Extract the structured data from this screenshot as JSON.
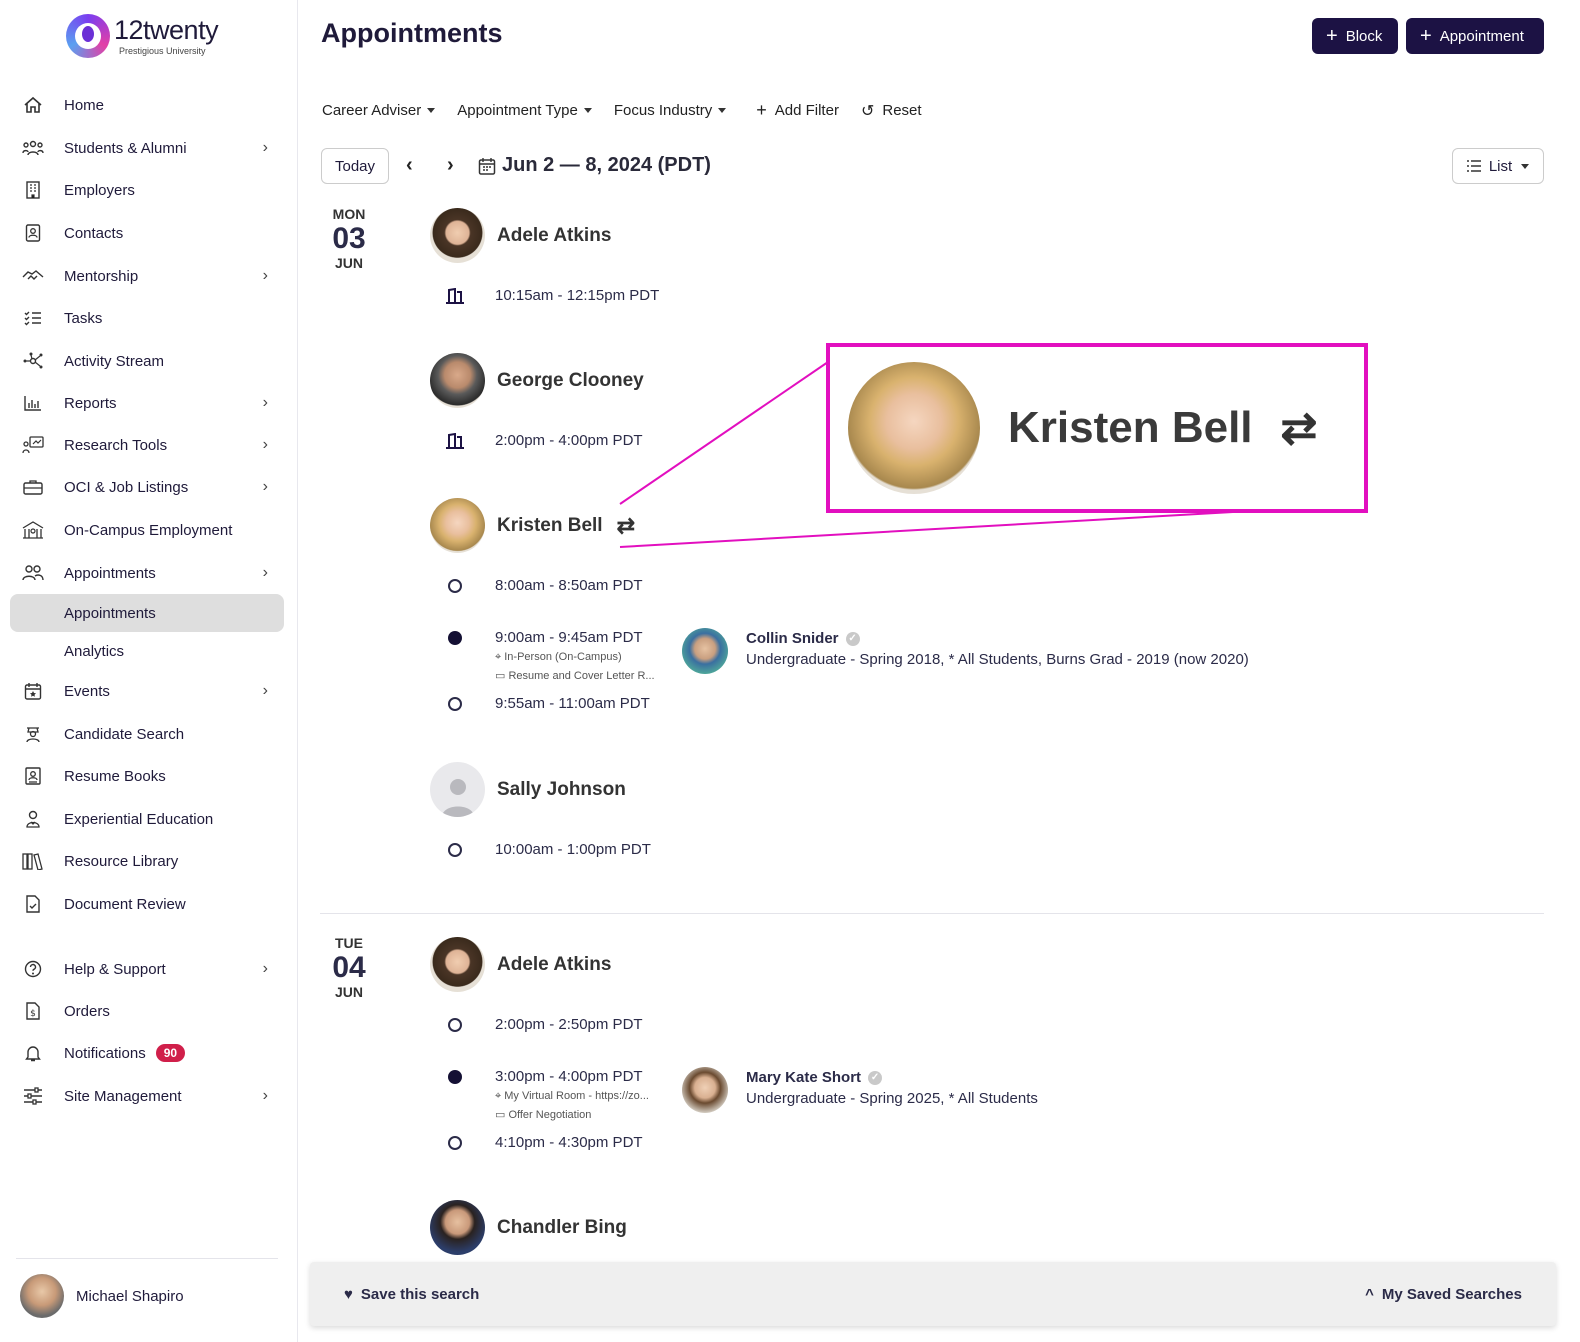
{
  "brand": {
    "name": "12twenty",
    "subtitle": "Prestigious University"
  },
  "sidebar": {
    "items": [
      {
        "label": "Home",
        "icon": "home-icon"
      },
      {
        "label": "Students & Alumni",
        "icon": "users-icon"
      },
      {
        "label": "Employers",
        "icon": "building-icon"
      },
      {
        "label": "Contacts",
        "icon": "contact-card-icon"
      },
      {
        "label": "Mentorship",
        "icon": "handshake-icon"
      },
      {
        "label": "Tasks",
        "icon": "checklist-icon"
      },
      {
        "label": "Activity Stream",
        "icon": "network-icon"
      },
      {
        "label": "Reports",
        "icon": "bar-chart-icon"
      },
      {
        "label": "Research Tools",
        "icon": "research-icon"
      },
      {
        "label": "OCI & Job Listings",
        "icon": "briefcase-icon"
      },
      {
        "label": "On-Campus Employment",
        "icon": "campus-icon"
      },
      {
        "label": "Appointments",
        "icon": "people-icon"
      },
      {
        "label": "Appointments"
      },
      {
        "label": "Analytics"
      },
      {
        "label": "Events",
        "icon": "calendar-star-icon"
      },
      {
        "label": "Candidate Search",
        "icon": "candidate-search-icon"
      },
      {
        "label": "Resume Books",
        "icon": "resume-book-icon"
      },
      {
        "label": "Experiential Education",
        "icon": "person-badge-icon"
      },
      {
        "label": "Resource Library",
        "icon": "library-icon"
      },
      {
        "label": "Document Review",
        "icon": "document-check-icon"
      },
      {
        "label": "Help & Support",
        "icon": "help-icon"
      },
      {
        "label": "Orders",
        "icon": "receipt-icon"
      },
      {
        "label": "Notifications",
        "icon": "bell-icon",
        "badge": "90"
      },
      {
        "label": "Site Management",
        "icon": "sliders-icon"
      }
    ],
    "user": {
      "name": "Michael Shapiro"
    }
  },
  "header": {
    "title": "Appointments",
    "block_label": "Block",
    "appointment_label": "Appointment"
  },
  "filters": {
    "career_adviser": "Career Adviser",
    "appointment_type": "Appointment Type",
    "focus_industry": "Focus Industry",
    "add_filter": "Add Filter",
    "reset": "Reset"
  },
  "toolbar": {
    "today": "Today",
    "date_range": "Jun 2 — 8, 2024 (PDT)",
    "view": "List"
  },
  "days": [
    {
      "dow": "MON",
      "day": "03",
      "month": "JUN",
      "advisers": [
        {
          "name": "Adele Atkins",
          "slots": [
            {
              "time": "10:15am - 12:15pm PDT"
            }
          ]
        },
        {
          "name": "George Clooney",
          "slots": [
            {
              "time": "2:00pm - 4:00pm PDT"
            }
          ]
        },
        {
          "name": "Kristen Bell",
          "slots": [
            {
              "time": "8:00am - 8:50am PDT"
            },
            {
              "time": "9:00am - 9:45am PDT",
              "location": "In-Person (On-Campus)",
              "topic": "Resume and Cover Letter R...",
              "student": {
                "name": "Collin Snider",
                "desc": "Undergraduate - Spring 2018, * All Students, Burns Grad - 2019 (now 2020)"
              }
            },
            {
              "time": "9:55am - 11:00am PDT"
            }
          ]
        },
        {
          "name": "Sally Johnson",
          "slots": [
            {
              "time": "10:00am - 1:00pm PDT"
            }
          ]
        }
      ]
    },
    {
      "dow": "TUE",
      "day": "04",
      "month": "JUN",
      "advisers": [
        {
          "name": "Adele Atkins",
          "slots": [
            {
              "time": "2:00pm - 2:50pm PDT"
            },
            {
              "time": "3:00pm - 4:00pm PDT",
              "location": "My Virtual Room - https://zo...",
              "topic": "Offer Negotiation",
              "student": {
                "name": "Mary Kate Short",
                "desc": "Undergraduate - Spring 2025, * All Students"
              }
            },
            {
              "time": "4:10pm - 4:30pm PDT"
            }
          ]
        },
        {
          "name": "Chandler Bing"
        }
      ]
    }
  ],
  "callout": {
    "name": "Kristen Bell"
  },
  "bottombar": {
    "save_search": "Save this search",
    "saved_searches": "My Saved Searches"
  },
  "colors": {
    "accent": "#1c1244",
    "badge": "#d01f4a",
    "callout_border": "#e20fbf"
  }
}
